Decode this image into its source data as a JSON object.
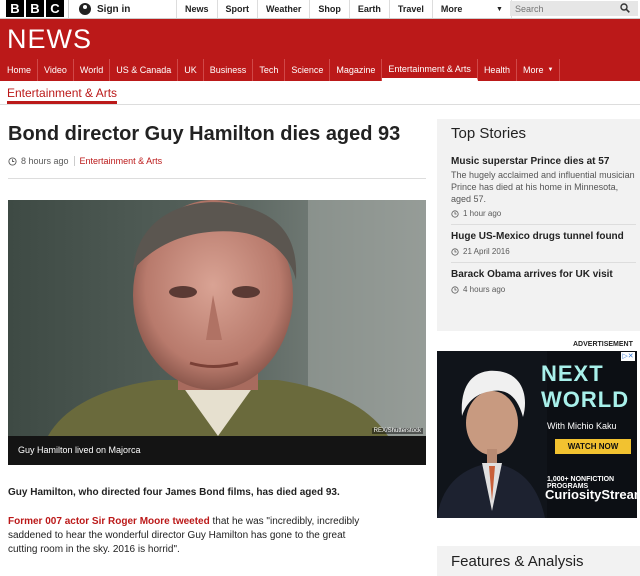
{
  "brand": {
    "bbc_letters": [
      "B",
      "B",
      "C"
    ],
    "news_logo": "NEWS"
  },
  "topbar": {
    "signin": "Sign in",
    "nav": [
      "News",
      "Sport",
      "Weather",
      "Shop",
      "Earth",
      "Travel"
    ],
    "more": "More",
    "search_placeholder": "Search"
  },
  "mainnav": {
    "items": [
      "Home",
      "Video",
      "World",
      "US & Canada",
      "UK",
      "Business",
      "Tech",
      "Science",
      "Magazine",
      "Entertainment & Arts",
      "Health"
    ],
    "active": "Entertainment & Arts",
    "more": "More"
  },
  "section": "Entertainment & Arts",
  "article": {
    "headline": "Bond director Guy Hamilton dies aged 93",
    "time": "8 hours ago",
    "section_link": "Entertainment & Arts",
    "photo_credit": "REX/Shutterstock",
    "caption": "Guy Hamilton lived on Majorca",
    "lead": "Guy Hamilton, who directed four James Bond films, has died aged 93.",
    "para_link": "Former 007 actor Sir Roger Moore tweeted",
    "para_text": " that he was \"incredibly, incredibly saddened to hear the wonderful director Guy Hamilton has gone to the great cutting room in the sky. 2016 is horrid\"."
  },
  "top_stories": {
    "heading": "Top Stories",
    "stories": [
      {
        "title": "Music superstar Prince dies at 57",
        "summary": "The hugely acclaimed and influential musician Prince has died at his home in Minnesota, aged 57.",
        "time": "1 hour ago"
      },
      {
        "title": "Huge US-Mexico drugs tunnel found",
        "summary": "",
        "time": "21 April 2016"
      },
      {
        "title": "Barack Obama arrives for UK visit",
        "summary": "",
        "time": "4 hours ago"
      }
    ]
  },
  "advertisement": {
    "label": "ADVERTISEMENT",
    "line1": "NEXT",
    "line2": "WORLD",
    "host": "With Michio Kaku",
    "cta": "WATCH NOW",
    "promo": "1,000+ NONFICTION PROGRAMS",
    "brand": "CuriosityStream"
  },
  "features": {
    "heading": "Features & Analysis"
  },
  "colors": {
    "bbc_red": "#bb1919",
    "ad_accent": "#a8f0ea",
    "cta_yellow": "#f2c230"
  }
}
